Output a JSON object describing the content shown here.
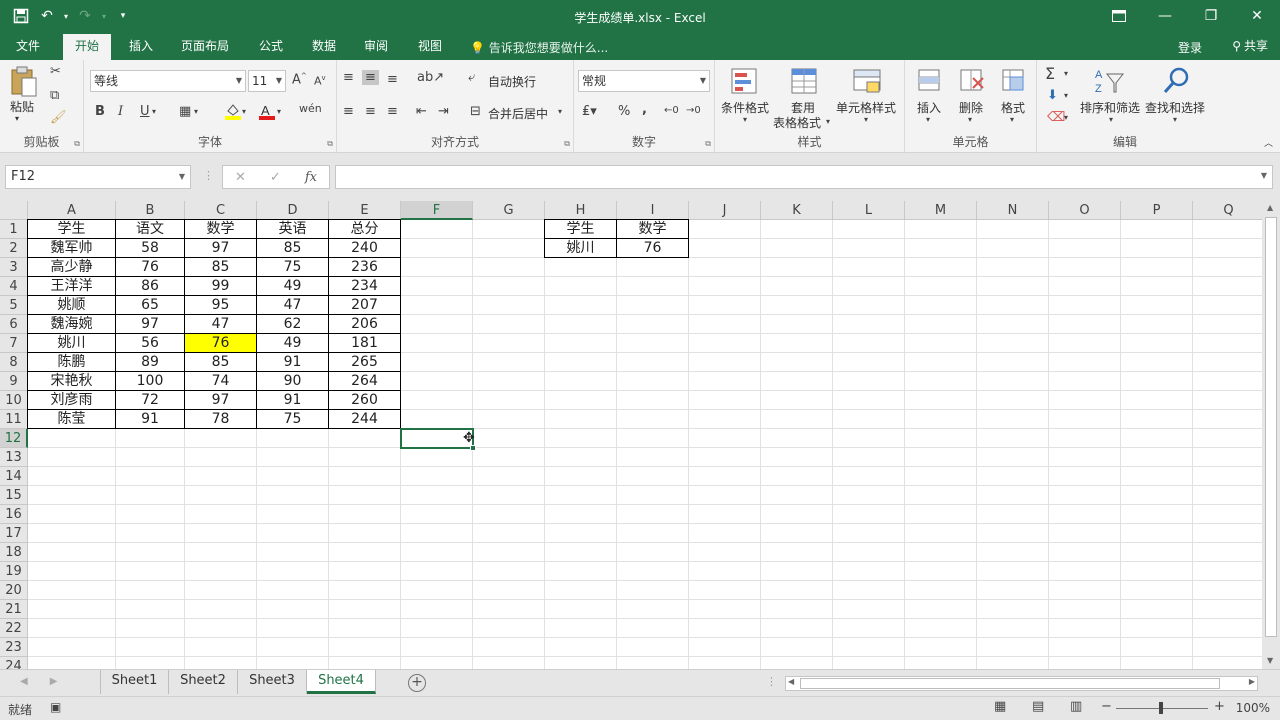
{
  "window": {
    "title": "学生成绩单.xlsx - Excel"
  },
  "tabs": [
    "文件",
    "开始",
    "插入",
    "页面布局",
    "公式",
    "数据",
    "审阅",
    "视图"
  ],
  "tell_me": "告诉我您想要做什么...",
  "account": {
    "login": "登录",
    "share": "共享"
  },
  "ribbon": {
    "clipboard": {
      "paste": "粘贴",
      "label": "剪贴板"
    },
    "font": {
      "name": "等线",
      "size": "11",
      "label": "字体",
      "bold": "B",
      "italic": "I",
      "underline": "U"
    },
    "alignment": {
      "wrap": "自动换行",
      "merge": "合并后居中",
      "label": "对齐方式"
    },
    "number": {
      "format": "常规",
      "label": "数字",
      "percent": "%",
      "comma": ","
    },
    "styles": {
      "conditional": "条件格式",
      "table": "套用",
      "table2": "表格格式",
      "cell": "单元格样式",
      "label": "样式"
    },
    "cells": {
      "insert": "插入",
      "delete": "删除",
      "format": "格式",
      "label": "单元格"
    },
    "editing": {
      "sort": "排序和筛选",
      "find": "查找和选择",
      "label": "编辑",
      "sum": "Σ"
    }
  },
  "formula_bar": {
    "name_box": "F12",
    "fx": "fx",
    "content": ""
  },
  "columns": [
    "A",
    "B",
    "C",
    "D",
    "E",
    "F",
    "G",
    "H",
    "I",
    "J",
    "K",
    "L",
    "M",
    "N",
    "O",
    "P",
    "Q"
  ],
  "rows": [
    "1",
    "2",
    "3",
    "4",
    "5",
    "6",
    "7",
    "8",
    "9",
    "10",
    "11",
    "12",
    "13",
    "14",
    "15",
    "16",
    "17",
    "18",
    "19",
    "20",
    "21",
    "22",
    "23",
    "24"
  ],
  "table": {
    "headers": [
      "学生",
      "语文",
      "数学",
      "英语",
      "总分"
    ],
    "rows": [
      [
        "魏军帅",
        "58",
        "97",
        "85",
        "240"
      ],
      [
        "高少静",
        "76",
        "85",
        "75",
        "236"
      ],
      [
        "王洋洋",
        "86",
        "99",
        "49",
        "234"
      ],
      [
        "姚顺",
        "65",
        "95",
        "47",
        "207"
      ],
      [
        "魏海婉",
        "97",
        "47",
        "62",
        "206"
      ],
      [
        "姚川",
        "56",
        "76",
        "49",
        "181"
      ],
      [
        "陈鹏",
        "89",
        "85",
        "91",
        "265"
      ],
      [
        "宋艳秋",
        "100",
        "74",
        "90",
        "264"
      ],
      [
        "刘彦雨",
        "72",
        "97",
        "91",
        "260"
      ],
      [
        "陈莹",
        "91",
        "78",
        "75",
        "244"
      ]
    ]
  },
  "lookup": {
    "headers": [
      "学生",
      "数学"
    ],
    "row": [
      "姚川",
      "76"
    ]
  },
  "highlight_color": "#ffff00",
  "sheets": [
    "Sheet1",
    "Sheet2",
    "Sheet3",
    "Sheet4"
  ],
  "active_sheet": "Sheet4",
  "status": {
    "ready": "就绪",
    "zoom": "100%"
  },
  "accent_color": "#217346"
}
